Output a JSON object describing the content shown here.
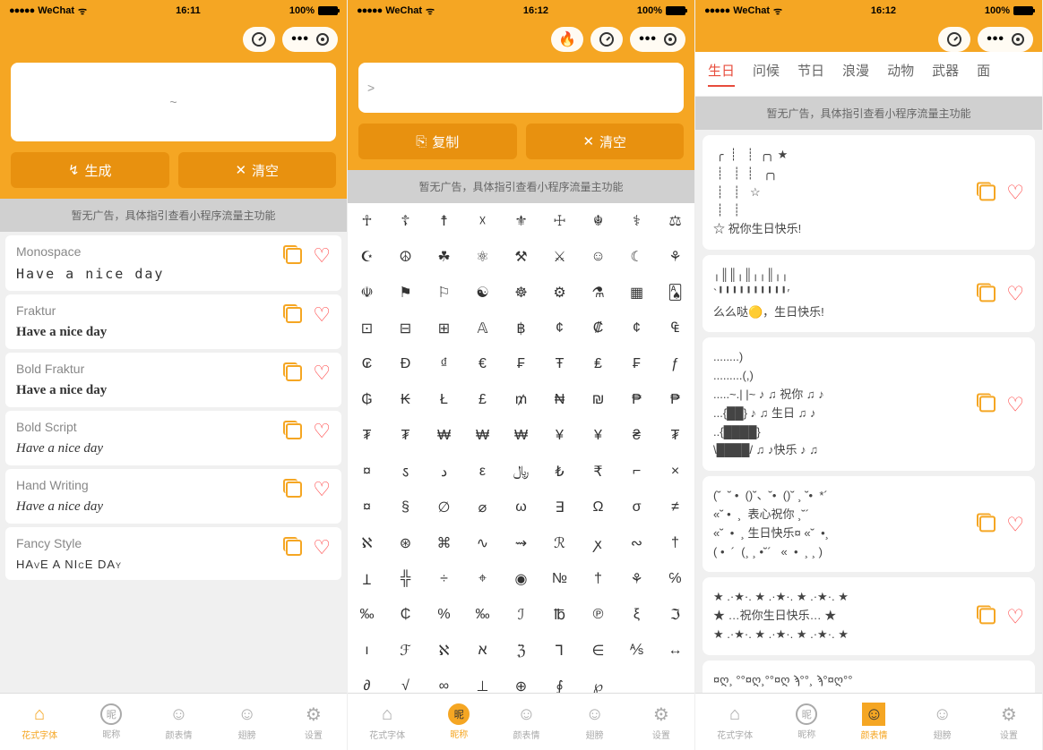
{
  "status": {
    "carrier": "WeChat",
    "wifi": "ᯤ",
    "battery_pct": "100%"
  },
  "times": {
    "s1": "16:11",
    "s2": "16:12",
    "s3": "16:12"
  },
  "s1": {
    "input_placeholder": "~",
    "btn_generate": "生成",
    "btn_clear": "清空",
    "ad": "暂无广告，具体指引查看小程序流量主功能",
    "fonts": [
      {
        "name": "Monospace",
        "sample": "Have a nice day",
        "cls": "mono"
      },
      {
        "name": "Fraktur",
        "sample": "Have a nice day",
        "cls": "fraktur"
      },
      {
        "name": "Bold Fraktur",
        "sample": "Have a nice day",
        "cls": "fraktur"
      },
      {
        "name": "Bold Script",
        "sample": "Have a nice day",
        "cls": "script"
      },
      {
        "name": "Hand Writing",
        "sample": "Have a nice day",
        "cls": "script"
      },
      {
        "name": "Fancy Style",
        "sample": "HAvE A NIcE DAy",
        "cls": "smallcaps"
      }
    ]
  },
  "s2": {
    "input_placeholder": ">",
    "btn_copy": "复制",
    "btn_clear": "清空",
    "ad": "暂无广告，具体指引查看小程序流量主功能",
    "symbols": [
      "☥",
      "☦",
      "☨",
      "☓",
      "⚜",
      "☩",
      "☬",
      "⚕",
      "⚖",
      "☪",
      "☮",
      "☘",
      "⚛",
      "⚒",
      "⚔",
      "☺",
      "☾",
      "⚘",
      "☫",
      "⚑",
      "⚐",
      "☯",
      "☸",
      "⚙",
      "⚗",
      "▦",
      "🂡",
      "⊡",
      "⊟",
      "⊞",
      "𝔸",
      "฿",
      "¢",
      "₡",
      "¢",
      "₠",
      "₢",
      "Đ",
      "₫",
      "€",
      "₣",
      "Ŧ",
      "₤",
      "₣",
      "ƒ",
      "₲",
      "₭",
      "Ł",
      "£",
      "₥",
      "₦",
      "₪",
      "₱",
      "₱",
      "₮",
      "₮",
      "₩",
      "₩",
      "₩",
      "¥",
      "¥",
      "₴",
      "₮",
      "¤",
      "ऽ",
      "د",
      "ε",
      "﷼",
      "₺",
      "₹",
      "⌐",
      "×",
      "¤",
      "§",
      "∅",
      "⌀",
      "ω",
      "∃",
      "Ω",
      "σ",
      "≠",
      "ℵ",
      "⊛",
      "⌘",
      "∿",
      "⇝",
      "ℛ",
      "ꭗ",
      "∾",
      "†",
      "Ʇ",
      "╬",
      "÷",
      "⌖",
      "◉",
      "№",
      "†",
      "⚘",
      "℅",
      "‰",
      "₵",
      "%",
      "‰",
      "ℐ",
      "℔",
      "℗",
      "ξ",
      "ℑ",
      "ı",
      "ℱ",
      "ℵ",
      "א",
      "ℨ",
      "⅂",
      "∈",
      "⅍",
      "↔",
      "∂",
      "√",
      "∞",
      "⊥",
      "⊕",
      "∮",
      "℘"
    ]
  },
  "s3": {
    "ad": "暂无广告，具体指引查看小程序流量主功能",
    "tabs": [
      "生日",
      "问候",
      "节日",
      "浪漫",
      "动物",
      "武器",
      "面"
    ],
    "active_tab": 0,
    "cards": [
      " ╭  ┊   ┊  ╭╮ ★\n ┊   ┊  ┊   ╭╮\n ┊   ┊   ☆\n ┊   ┊\n☆ 祝你生日快乐!",
      "╷║║╷║╷╷║╷╷\n`╹╹╹╹╹╹╹╹╹╹′\n么么哒🟡，生日快乐!",
      "........)\n.........(,)\n.....~.| |~ ♪ ♫ 祝你 ♫ ♪\n...{██} ♪ ♫ 生日 ♫ ♪\n..{████}\n\\████/ ♫ ♪快乐 ♪ ♫",
      "(˘  ˘ •  ()˘、˘•  ()˘ ¸ ˘•  *´\n«˘ •  ¸  表心祝你 ¸˘´\n«˘  •  ¸ 生日快乐¤ «˘  •¸\n( •  ´  (¸ ¸ •˘´   «  •  ¸ ¸ )",
      "★ .·★·. ★ .·★·. ★ .·★·. ★\n★ …祝你生日快乐… ★\n★ .·★·. ★ .·★·. ★ .·★·. ★",
      "¤ღ¸ °°¤ღ¸°°¤ღ ϡ°°¸ ϡ°¤ღ°°\n°°¤ღ¸ HaPpY ¸°°¤ღ°°\n¸ϡ°¤ღ°°BiRtHday °°¤ღ¸°\n¸ϡ¤ღ °°¤ღ°°¸ ¸ϡ°°¤ღ¸°"
    ]
  },
  "nav": {
    "items": [
      "花式字体",
      "昵称",
      "颜表情",
      "翅膀",
      "设置"
    ]
  }
}
